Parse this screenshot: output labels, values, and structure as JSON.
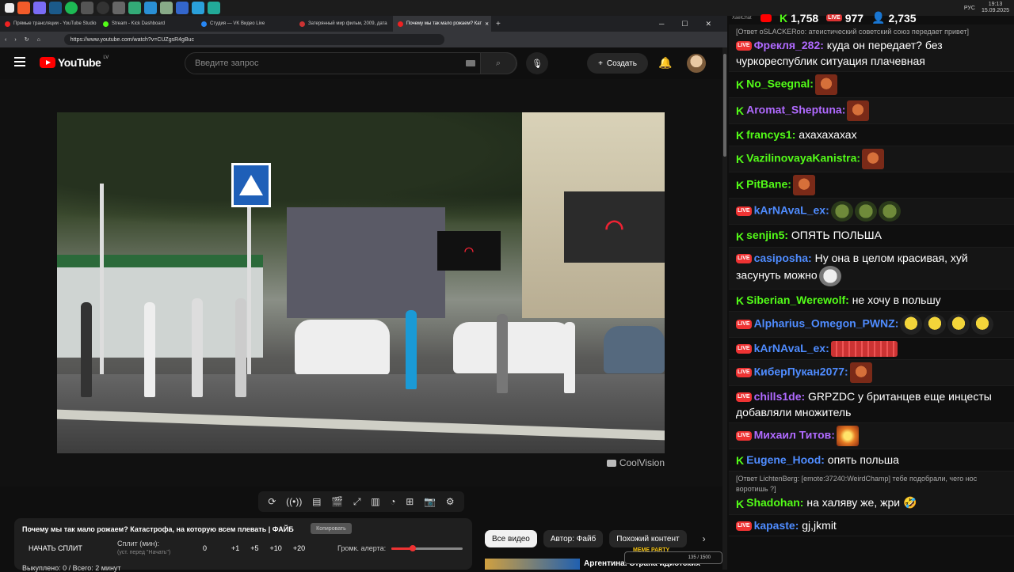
{
  "browser": {
    "tabs": [
      {
        "label": "Прямые трансляции - YouTube Studio",
        "icon": "youtube-icon",
        "active": false
      },
      {
        "label": "Stream - Kick Dashboard",
        "icon": "kick-icon",
        "active": false
      },
      {
        "label": "Студия — VK Видео Live",
        "icon": "vk-icon",
        "active": false
      },
      {
        "label": "Затерянный мир фильм, 2009, дата",
        "icon": "page-icon",
        "active": false
      },
      {
        "label": "Почему мы так мало рожаем? Кат",
        "icon": "youtube-icon",
        "active": true
      }
    ],
    "url": "https://www.youtube.com/watch?v=CUZgsR4gBuc"
  },
  "system": {
    "lang": "РУС",
    "time": "19:13",
    "date": "15.09.2025"
  },
  "youtube": {
    "logo_text": "YouTube",
    "region": "LV",
    "search_placeholder": "Введите запрос",
    "create_label": "Создать"
  },
  "video": {
    "watermark": "CoolVision"
  },
  "extension": {
    "title": "Почему мы так мало рожаем? Катастрофа, на которую всем плевать | ФАЙБ",
    "copy_label": "Копировать",
    "split_button": "НАЧАТЬ СПЛИТ",
    "split_label": "Сплит (мин):",
    "split_sub": "(уст. перед \"Начать\")",
    "split_value": "0",
    "increments": [
      "+1",
      "+5",
      "+10",
      "+20"
    ],
    "volume_label": "Громк. алерта:",
    "volume_level": 0.3,
    "bought": "Выкуплено: 0 / Всего: 2 минут"
  },
  "chips": [
    "Все видео",
    "Автор: Файб",
    "Похожий контент"
  ],
  "rec": {
    "title": "Аргентина. Страна идиотских"
  },
  "meme_party": {
    "label": "MEME PARTY",
    "progress": "135 / 1500"
  },
  "chat": {
    "app_title": "XaelChat",
    "stats": {
      "kick": "1,758",
      "vk": "977",
      "viewers": "2,735"
    },
    "messages": [
      {
        "platform": "vk",
        "nick": "Фрекля_282:",
        "color": "#b06aff",
        "reply": "[Ответ oSLACKERoo: атеистический советский союз передает привет]",
        "text": "куда он передает? без чуркореспублик ситуация плачевная",
        "emotes": []
      },
      {
        "platform": "kick",
        "nick": "No_Seegnal:",
        "color": "#53fc18",
        "text": "",
        "emotes": [
          "face"
        ]
      },
      {
        "platform": "kick",
        "nick": "Aromat_Sheptuna:",
        "color": "#b06aff",
        "text": "",
        "emotes": [
          "face"
        ]
      },
      {
        "platform": "kick",
        "nick": "francys1:",
        "color": "#53fc18",
        "text": "ахахахахах",
        "emotes": []
      },
      {
        "platform": "kick",
        "nick": "VazilinovayaKanistra:",
        "color": "#53fc18",
        "text": "",
        "emotes": [
          "face"
        ]
      },
      {
        "platform": "kick",
        "nick": "PitBane:",
        "color": "#53fc18",
        "text": "",
        "emotes": [
          "face"
        ]
      },
      {
        "platform": "vk",
        "nick": "kArNAvaL_ex:",
        "color": "#4f8cff",
        "text": "",
        "emotes": [
          "pepe",
          "pepe",
          "pepe"
        ]
      },
      {
        "platform": "kick",
        "nick": "senjin5:",
        "color": "#53fc18",
        "text": "ОПЯТЬ ПОЛЬША",
        "emotes": []
      },
      {
        "platform": "vk",
        "nick": "casiposha:",
        "color": "#4f8cff",
        "text": "Ну она в целом красивая, хуй засунуть можно",
        "emotes": [
          "smile"
        ]
      },
      {
        "platform": "kick",
        "nick": "Siberian_Werewolf:",
        "color": "#53fc18",
        "text": "не хочу в польшу",
        "emotes": []
      },
      {
        "platform": "vk",
        "nick": "Alpharius_Omegon_PWNZ:",
        "color": "#4f8cff",
        "text": "",
        "emotes": [
          "yellow",
          "yellow",
          "yellow",
          "yellow"
        ]
      },
      {
        "platform": "vk",
        "nick": "kArNAvaL_ex:",
        "color": "#4f8cff",
        "text": "",
        "emotes": [
          "text"
        ]
      },
      {
        "platform": "vk",
        "nick": "КиберПукан2077:",
        "color": "#4f8cff",
        "text": "",
        "emotes": [
          "face"
        ]
      },
      {
        "platform": "vk",
        "nick": "chills1de:",
        "color": "#b06aff",
        "text": "GRPZDC у британцев еще инцесты добавляли множитель",
        "emotes": []
      },
      {
        "platform": "vk",
        "nick": "Михаил Титов:",
        "color": "#b06aff",
        "text": "",
        "emotes": [
          "explode"
        ]
      },
      {
        "platform": "kick",
        "nick": "Eugene_Hood:",
        "color": "#4f8cff",
        "text": "опять польша",
        "emotes": []
      },
      {
        "platform": "kick",
        "nick": "Shadohan:",
        "color": "#53fc18",
        "reply": "[Ответ LichtenBerg: [emote:37240:WeirdChamp] тебе подобрали, чего нос воротишь ?]",
        "text": "на халяву же, жри 🤣",
        "emotes": []
      },
      {
        "platform": "vk",
        "nick": "kapaste:",
        "color": "#4f8cff",
        "text": "gj,jkmit",
        "emotes": []
      }
    ]
  }
}
